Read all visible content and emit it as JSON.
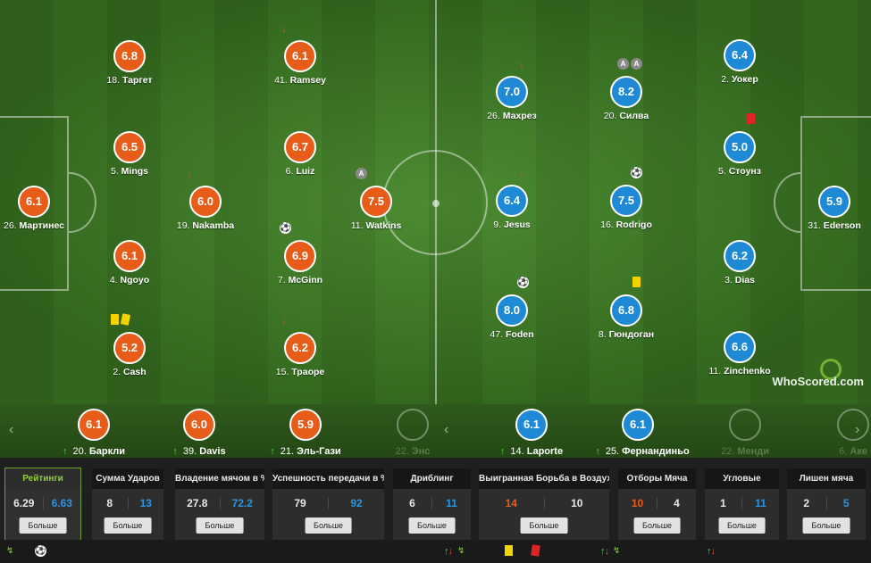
{
  "colors": {
    "home": "#e85c1a",
    "away": "#1e8ad6",
    "accent": "#8fcf3a"
  },
  "watermark": "WhoScored.com",
  "home_players": [
    {
      "rating": "6.1",
      "number": "26.",
      "name": "Мартинес"
    },
    {
      "rating": "6.8",
      "number": "18.",
      "name": "Таргет"
    },
    {
      "rating": "6.5",
      "number": "5.",
      "name": "Mings"
    },
    {
      "rating": "6.1",
      "number": "4.",
      "name": "Ngoyo"
    },
    {
      "rating": "5.2",
      "number": "2.",
      "name": "Cash"
    },
    {
      "rating": "6.0",
      "number": "19.",
      "name": "Nakamba"
    },
    {
      "rating": "6.1",
      "number": "41.",
      "name": "Ramsey"
    },
    {
      "rating": "6.7",
      "number": "6.",
      "name": "Luiz"
    },
    {
      "rating": "6.9",
      "number": "7.",
      "name": "McGinn"
    },
    {
      "rating": "6.2",
      "number": "15.",
      "name": "Траоре"
    },
    {
      "rating": "7.5",
      "number": "11.",
      "name": "Watkins"
    }
  ],
  "away_players": [
    {
      "rating": "7.0",
      "number": "26.",
      "name": "Махрез"
    },
    {
      "rating": "6.4",
      "number": "9.",
      "name": "Jesus"
    },
    {
      "rating": "8.0",
      "number": "47.",
      "name": "Foden"
    },
    {
      "rating": "8.2",
      "number": "20.",
      "name": "Силва"
    },
    {
      "rating": "7.5",
      "number": "16.",
      "name": "Rodrigo"
    },
    {
      "rating": "6.8",
      "number": "8.",
      "name": "Гюндоган"
    },
    {
      "rating": "6.4",
      "number": "2.",
      "name": "Уокер"
    },
    {
      "rating": "5.0",
      "number": "5.",
      "name": "Стоунз"
    },
    {
      "rating": "6.2",
      "number": "3.",
      "name": "Dias"
    },
    {
      "rating": "6.6",
      "number": "11.",
      "name": "Zinchenko"
    },
    {
      "rating": "5.9",
      "number": "31.",
      "name": "Ederson"
    }
  ],
  "bench": {
    "home": [
      {
        "rating": "6.1",
        "number": "20.",
        "name": "Баркли"
      },
      {
        "rating": "6.0",
        "number": "39.",
        "name": "Davis"
      },
      {
        "rating": "5.9",
        "number": "21.",
        "name": "Эль-Гази"
      },
      {
        "rating": "",
        "number": "22.",
        "name": "Энс"
      }
    ],
    "away": [
      {
        "rating": "6.1",
        "number": "14.",
        "name": "Laporte"
      },
      {
        "rating": "6.1",
        "number": "25.",
        "name": "Фернандиньо"
      },
      {
        "rating": "",
        "number": "22.",
        "name": "Менди"
      },
      {
        "rating": "",
        "number": "6.",
        "name": "Аке"
      }
    ]
  },
  "stats": [
    {
      "title": "Рейтинги",
      "home": "6.29",
      "away": "6.63",
      "more": "Больше"
    },
    {
      "title": "Сумма Ударов",
      "home": "8",
      "away": "13",
      "more": "Больше"
    },
    {
      "title": "Владение мячом в %",
      "home": "27.8",
      "away": "72.2",
      "more": "Больше"
    },
    {
      "title": "Успешность передачи в %",
      "home": "79",
      "away": "92",
      "more": "Больше"
    },
    {
      "title": "Дриблинг",
      "home": "6",
      "away": "11",
      "more": "Больше"
    },
    {
      "title": "Выигранная Борьба в Воздухе",
      "home": "14",
      "away": "10",
      "more": "Больше"
    },
    {
      "title": "Отборы Мяча",
      "home": "10",
      "away": "4",
      "more": "Больше"
    },
    {
      "title": "Угловые",
      "home": "1",
      "away": "11",
      "more": "Больше"
    },
    {
      "title": "Лишен мяча",
      "home": "2",
      "away": "5",
      "more": "Больше"
    }
  ],
  "icons": {
    "captain": "A",
    "ball": "⚽",
    "sub_out": "↓",
    "sub_in": "↑",
    "prev": "‹",
    "next": "›"
  }
}
